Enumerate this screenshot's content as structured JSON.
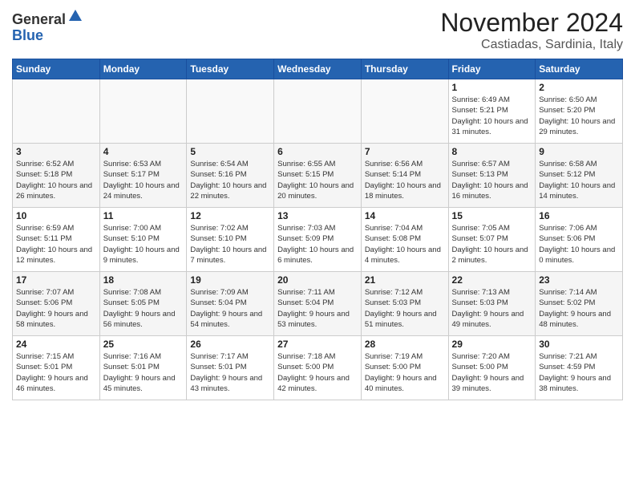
{
  "header": {
    "logo_line1": "General",
    "logo_line2": "Blue",
    "month_year": "November 2024",
    "location": "Castiadas, Sardinia, Italy"
  },
  "weekdays": [
    "Sunday",
    "Monday",
    "Tuesday",
    "Wednesday",
    "Thursday",
    "Friday",
    "Saturday"
  ],
  "weeks": [
    [
      {
        "day": "",
        "info": ""
      },
      {
        "day": "",
        "info": ""
      },
      {
        "day": "",
        "info": ""
      },
      {
        "day": "",
        "info": ""
      },
      {
        "day": "",
        "info": ""
      },
      {
        "day": "1",
        "info": "Sunrise: 6:49 AM\nSunset: 5:21 PM\nDaylight: 10 hours\nand 31 minutes."
      },
      {
        "day": "2",
        "info": "Sunrise: 6:50 AM\nSunset: 5:20 PM\nDaylight: 10 hours\nand 29 minutes."
      }
    ],
    [
      {
        "day": "3",
        "info": "Sunrise: 6:52 AM\nSunset: 5:18 PM\nDaylight: 10 hours\nand 26 minutes."
      },
      {
        "day": "4",
        "info": "Sunrise: 6:53 AM\nSunset: 5:17 PM\nDaylight: 10 hours\nand 24 minutes."
      },
      {
        "day": "5",
        "info": "Sunrise: 6:54 AM\nSunset: 5:16 PM\nDaylight: 10 hours\nand 22 minutes."
      },
      {
        "day": "6",
        "info": "Sunrise: 6:55 AM\nSunset: 5:15 PM\nDaylight: 10 hours\nand 20 minutes."
      },
      {
        "day": "7",
        "info": "Sunrise: 6:56 AM\nSunset: 5:14 PM\nDaylight: 10 hours\nand 18 minutes."
      },
      {
        "day": "8",
        "info": "Sunrise: 6:57 AM\nSunset: 5:13 PM\nDaylight: 10 hours\nand 16 minutes."
      },
      {
        "day": "9",
        "info": "Sunrise: 6:58 AM\nSunset: 5:12 PM\nDaylight: 10 hours\nand 14 minutes."
      }
    ],
    [
      {
        "day": "10",
        "info": "Sunrise: 6:59 AM\nSunset: 5:11 PM\nDaylight: 10 hours\nand 12 minutes."
      },
      {
        "day": "11",
        "info": "Sunrise: 7:00 AM\nSunset: 5:10 PM\nDaylight: 10 hours\nand 9 minutes."
      },
      {
        "day": "12",
        "info": "Sunrise: 7:02 AM\nSunset: 5:10 PM\nDaylight: 10 hours\nand 7 minutes."
      },
      {
        "day": "13",
        "info": "Sunrise: 7:03 AM\nSunset: 5:09 PM\nDaylight: 10 hours\nand 6 minutes."
      },
      {
        "day": "14",
        "info": "Sunrise: 7:04 AM\nSunset: 5:08 PM\nDaylight: 10 hours\nand 4 minutes."
      },
      {
        "day": "15",
        "info": "Sunrise: 7:05 AM\nSunset: 5:07 PM\nDaylight: 10 hours\nand 2 minutes."
      },
      {
        "day": "16",
        "info": "Sunrise: 7:06 AM\nSunset: 5:06 PM\nDaylight: 10 hours\nand 0 minutes."
      }
    ],
    [
      {
        "day": "17",
        "info": "Sunrise: 7:07 AM\nSunset: 5:06 PM\nDaylight: 9 hours\nand 58 minutes."
      },
      {
        "day": "18",
        "info": "Sunrise: 7:08 AM\nSunset: 5:05 PM\nDaylight: 9 hours\nand 56 minutes."
      },
      {
        "day": "19",
        "info": "Sunrise: 7:09 AM\nSunset: 5:04 PM\nDaylight: 9 hours\nand 54 minutes."
      },
      {
        "day": "20",
        "info": "Sunrise: 7:11 AM\nSunset: 5:04 PM\nDaylight: 9 hours\nand 53 minutes."
      },
      {
        "day": "21",
        "info": "Sunrise: 7:12 AM\nSunset: 5:03 PM\nDaylight: 9 hours\nand 51 minutes."
      },
      {
        "day": "22",
        "info": "Sunrise: 7:13 AM\nSunset: 5:03 PM\nDaylight: 9 hours\nand 49 minutes."
      },
      {
        "day": "23",
        "info": "Sunrise: 7:14 AM\nSunset: 5:02 PM\nDaylight: 9 hours\nand 48 minutes."
      }
    ],
    [
      {
        "day": "24",
        "info": "Sunrise: 7:15 AM\nSunset: 5:01 PM\nDaylight: 9 hours\nand 46 minutes."
      },
      {
        "day": "25",
        "info": "Sunrise: 7:16 AM\nSunset: 5:01 PM\nDaylight: 9 hours\nand 45 minutes."
      },
      {
        "day": "26",
        "info": "Sunrise: 7:17 AM\nSunset: 5:01 PM\nDaylight: 9 hours\nand 43 minutes."
      },
      {
        "day": "27",
        "info": "Sunrise: 7:18 AM\nSunset: 5:00 PM\nDaylight: 9 hours\nand 42 minutes."
      },
      {
        "day": "28",
        "info": "Sunrise: 7:19 AM\nSunset: 5:00 PM\nDaylight: 9 hours\nand 40 minutes."
      },
      {
        "day": "29",
        "info": "Sunrise: 7:20 AM\nSunset: 5:00 PM\nDaylight: 9 hours\nand 39 minutes."
      },
      {
        "day": "30",
        "info": "Sunrise: 7:21 AM\nSunset: 4:59 PM\nDaylight: 9 hours\nand 38 minutes."
      }
    ]
  ]
}
